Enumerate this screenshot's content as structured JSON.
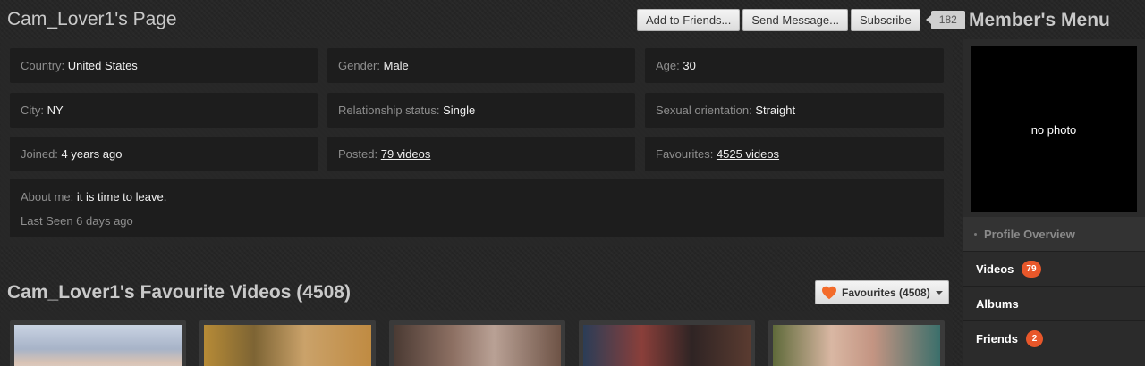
{
  "profile": {
    "title": "Cam_Lover1's Page",
    "actions": {
      "add_friend": "Add to Friends...",
      "send_message": "Send Message...",
      "subscribe": "Subscribe",
      "subscriber_count": "182"
    },
    "fields": {
      "country": {
        "label": "Country:",
        "value": "United States"
      },
      "gender": {
        "label": "Gender:",
        "value": "Male"
      },
      "age": {
        "label": "Age:",
        "value": "30"
      },
      "city": {
        "label": "City:",
        "value": "NY"
      },
      "relationship": {
        "label": "Relationship status:",
        "value": "Single"
      },
      "orientation": {
        "label": "Sexual orientation:",
        "value": "Straight"
      },
      "joined": {
        "label": "Joined:",
        "value": "4 years ago"
      },
      "posted": {
        "label": "Posted:",
        "value": "79 videos"
      },
      "favourites": {
        "label": "Favourites:",
        "value": "4525 videos"
      }
    },
    "about": {
      "label": "About me:",
      "value": "it is time to leave.",
      "last_seen": "Last Seen 6 days ago"
    }
  },
  "favourites_section": {
    "title": "Cam_Lover1's Favourite Videos (4508)",
    "dropdown_label": "Favourites (4508)",
    "heart_color": "#f36b2a",
    "thumbnails": [
      {
        "icon": "video-thumbnail"
      },
      {
        "icon": "video-thumbnail"
      },
      {
        "icon": "video-thumbnail"
      },
      {
        "icon": "video-thumbnail"
      },
      {
        "icon": "video-thumbnail"
      }
    ]
  },
  "sidebar": {
    "title": "Member's Menu",
    "photo_text": "no photo",
    "menu": [
      {
        "label": "Profile Overview"
      },
      {
        "label": "Videos",
        "badge": "79"
      },
      {
        "label": "Albums"
      },
      {
        "label": "Friends",
        "badge": "2"
      }
    ],
    "badge_color": "#e8572a"
  }
}
